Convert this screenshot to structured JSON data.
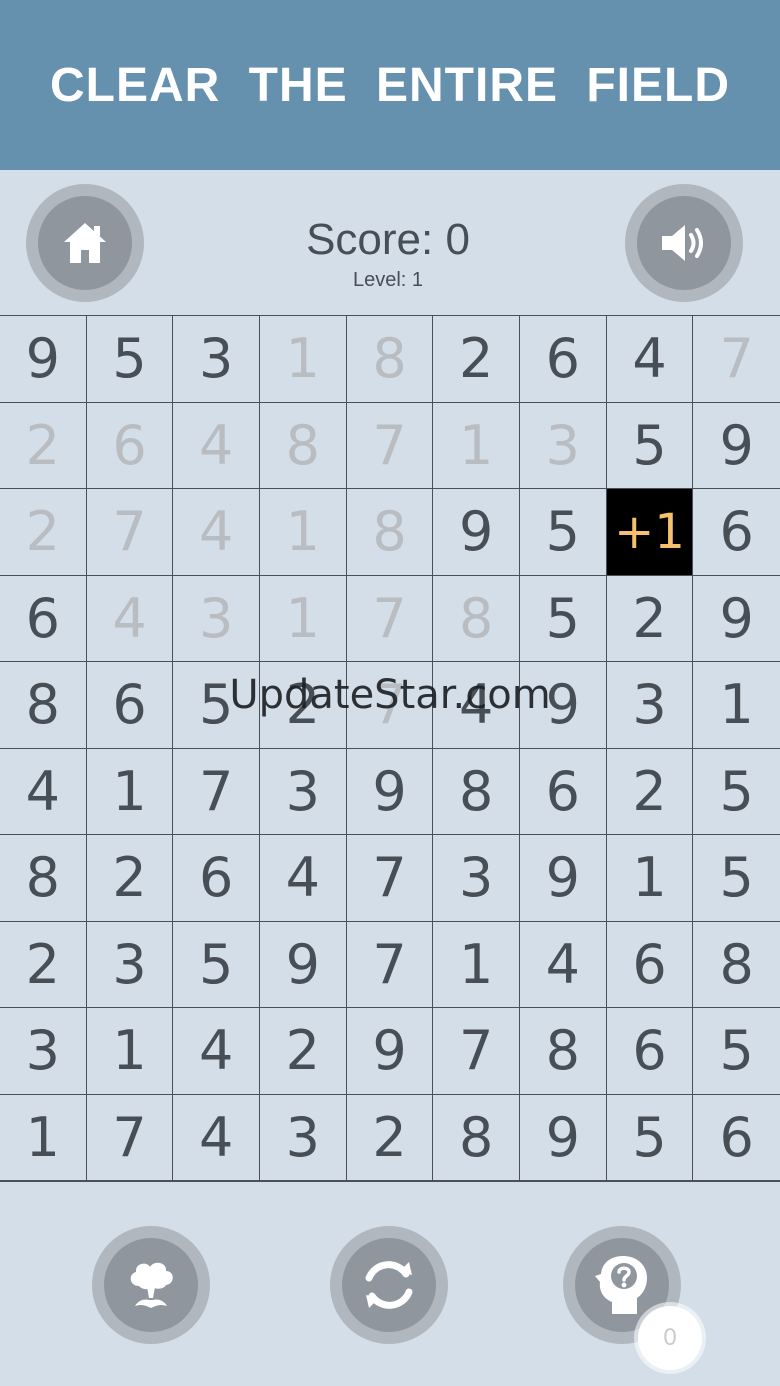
{
  "header": {
    "title": "CLEAR THE ENTIRE FIELD"
  },
  "status": {
    "score_label": "Score: 0",
    "level_label": "Level: 1"
  },
  "buttons": {
    "home": {
      "icon": "home-icon"
    },
    "sound": {
      "icon": "speaker-icon"
    },
    "bomb": {
      "icon": "explosion-icon"
    },
    "restart": {
      "icon": "refresh-icon"
    },
    "hint": {
      "icon": "head-question-icon",
      "count": "0"
    }
  },
  "board": {
    "rows": [
      [
        {
          "v": "9",
          "s": "active"
        },
        {
          "v": "5",
          "s": "active"
        },
        {
          "v": "3",
          "s": "active"
        },
        {
          "v": "1",
          "s": "cleared"
        },
        {
          "v": "8",
          "s": "cleared"
        },
        {
          "v": "2",
          "s": "active"
        },
        {
          "v": "6",
          "s": "active"
        },
        {
          "v": "4",
          "s": "active"
        },
        {
          "v": "7",
          "s": "cleared"
        }
      ],
      [
        {
          "v": "2",
          "s": "cleared"
        },
        {
          "v": "6",
          "s": "cleared"
        },
        {
          "v": "4",
          "s": "cleared"
        },
        {
          "v": "8",
          "s": "cleared"
        },
        {
          "v": "7",
          "s": "cleared"
        },
        {
          "v": "1",
          "s": "cleared"
        },
        {
          "v": "3",
          "s": "cleared"
        },
        {
          "v": "5",
          "s": "active"
        },
        {
          "v": "9",
          "s": "active"
        }
      ],
      [
        {
          "v": "2",
          "s": "cleared"
        },
        {
          "v": "7",
          "s": "cleared"
        },
        {
          "v": "4",
          "s": "cleared"
        },
        {
          "v": "1",
          "s": "cleared"
        },
        {
          "v": "8",
          "s": "cleared"
        },
        {
          "v": "9",
          "s": "active"
        },
        {
          "v": "5",
          "s": "active"
        },
        {
          "v": "+1",
          "s": "selected"
        },
        {
          "v": "6",
          "s": "active"
        }
      ],
      [
        {
          "v": "6",
          "s": "active"
        },
        {
          "v": "4",
          "s": "cleared"
        },
        {
          "v": "3",
          "s": "cleared"
        },
        {
          "v": "1",
          "s": "cleared"
        },
        {
          "v": "7",
          "s": "cleared"
        },
        {
          "v": "8",
          "s": "cleared"
        },
        {
          "v": "5",
          "s": "active"
        },
        {
          "v": "2",
          "s": "active"
        },
        {
          "v": "9",
          "s": "active"
        }
      ],
      [
        {
          "v": "8",
          "s": "active"
        },
        {
          "v": "6",
          "s": "active"
        },
        {
          "v": "5",
          "s": "active"
        },
        {
          "v": "2",
          "s": "active"
        },
        {
          "v": "7",
          "s": "cleared"
        },
        {
          "v": "4",
          "s": "active"
        },
        {
          "v": "9",
          "s": "active"
        },
        {
          "v": "3",
          "s": "active"
        },
        {
          "v": "1",
          "s": "active"
        }
      ],
      [
        {
          "v": "4",
          "s": "active"
        },
        {
          "v": "1",
          "s": "active"
        },
        {
          "v": "7",
          "s": "active"
        },
        {
          "v": "3",
          "s": "active"
        },
        {
          "v": "9",
          "s": "active"
        },
        {
          "v": "8",
          "s": "active"
        },
        {
          "v": "6",
          "s": "active"
        },
        {
          "v": "2",
          "s": "active"
        },
        {
          "v": "5",
          "s": "active"
        }
      ],
      [
        {
          "v": "8",
          "s": "active"
        },
        {
          "v": "2",
          "s": "active"
        },
        {
          "v": "6",
          "s": "active"
        },
        {
          "v": "4",
          "s": "active"
        },
        {
          "v": "7",
          "s": "active"
        },
        {
          "v": "3",
          "s": "active"
        },
        {
          "v": "9",
          "s": "active"
        },
        {
          "v": "1",
          "s": "active"
        },
        {
          "v": "5",
          "s": "active"
        }
      ],
      [
        {
          "v": "2",
          "s": "active"
        },
        {
          "v": "3",
          "s": "active"
        },
        {
          "v": "5",
          "s": "active"
        },
        {
          "v": "9",
          "s": "active"
        },
        {
          "v": "7",
          "s": "active"
        },
        {
          "v": "1",
          "s": "active"
        },
        {
          "v": "4",
          "s": "active"
        },
        {
          "v": "6",
          "s": "active"
        },
        {
          "v": "8",
          "s": "active"
        }
      ],
      [
        {
          "v": "3",
          "s": "active"
        },
        {
          "v": "1",
          "s": "active"
        },
        {
          "v": "4",
          "s": "active"
        },
        {
          "v": "2",
          "s": "active"
        },
        {
          "v": "9",
          "s": "active"
        },
        {
          "v": "7",
          "s": "active"
        },
        {
          "v": "8",
          "s": "active"
        },
        {
          "v": "6",
          "s": "active"
        },
        {
          "v": "5",
          "s": "active"
        }
      ],
      [
        {
          "v": "1",
          "s": "active"
        },
        {
          "v": "7",
          "s": "active"
        },
        {
          "v": "4",
          "s": "active"
        },
        {
          "v": "3",
          "s": "active"
        },
        {
          "v": "2",
          "s": "active"
        },
        {
          "v": "8",
          "s": "active"
        },
        {
          "v": "9",
          "s": "active"
        },
        {
          "v": "5",
          "s": "active"
        },
        {
          "v": "6",
          "s": "active"
        }
      ]
    ]
  },
  "watermark": {
    "text": "UpdateStar.com"
  },
  "colors": {
    "header_bg": "#6591ae",
    "page_bg": "#d3dee9",
    "active_digit": "#474e56",
    "cleared_digit": "#b9bdc1",
    "selected_bg": "#000000",
    "selected_digit": "#f6c16f"
  }
}
